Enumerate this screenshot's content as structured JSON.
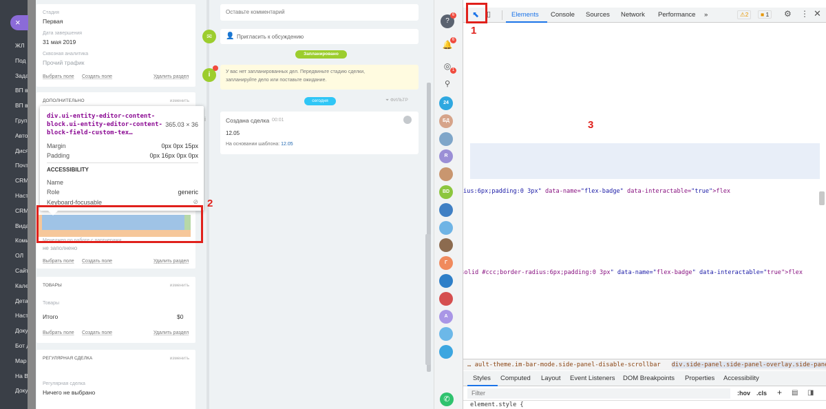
{
  "leftnav": {
    "close": "×",
    "items": [
      "ЖЛ",
      "Под",
      "Зада",
      "ВП в",
      "ВП в",
      "Груп",
      "Авто",
      "Дися",
      "Почт",
      "CRM",
      "Наст",
      "CRM",
      "Вида",
      "Коми",
      "ОЛ",
      "Сайт",
      "Кале",
      "Дета",
      "Наст",
      "Доку",
      "Бот д",
      "Мар",
      "На В",
      "Доку"
    ]
  },
  "crm": {
    "stage_label": "Стадия",
    "stage_value": "Первая",
    "close_date_label": "Дата завершения",
    "close_date_value": "31 мая 2019",
    "source_label": "Сквозная аналитика",
    "source_value": "Прочий трафик",
    "choose_field": "Выбрать поле",
    "create_field": "Создать поле",
    "delete_section": "Удалить раздел",
    "extra_header": "ДОПОЛНИТЕЛЬНО",
    "change": "изменить",
    "manager_label": "Менеджер по работе с партнерами",
    "manager_value": "не заполнено",
    "products_header": "ТОВАРЫ",
    "products_label": "Товары",
    "total_label": "Итого",
    "total_value": "$0",
    "recurring_header": "РЕГУЛЯРНАЯ СДЕЛКА",
    "recurring_label": "Регулярная сделка",
    "recurring_value": "Ничего не выбрано"
  },
  "stream": {
    "comment_placeholder": "Оставьте комментарий",
    "invite": "Пригласить к обсуждению",
    "planned_badge": "Запланировано",
    "info_text_1": "У вас нет запланированных дел. Передвиньте стадию сделки,",
    "info_text_2": "запланируйте дело или поставьте ожидание.",
    "today_badge": "сегодня",
    "filter": "ФИЛЬТР",
    "created_title": "Создана сделка",
    "created_time": "00:01",
    "created_value": "12.05",
    "based_on": "На основании шаблона:",
    "based_on_value": "12.05"
  },
  "tooltip": {
    "selector": "div.ui-entity-editor-content-block.ui-entity-editor-content-block-field-custom-tex…",
    "size": "365.03 × 36",
    "margin_label": "Margin",
    "margin_value": "0px 0px 15px",
    "padding_label": "Padding",
    "padding_value": "0px 16px 0px 0px",
    "accessibility": "ACCESSIBILITY",
    "name_label": "Name",
    "role_label": "Role",
    "role_value": "generic",
    "keyboard_label": "Keyboard-focusable"
  },
  "iconstrip": {
    "badges": [
      "6",
      "6",
      "1"
    ],
    "avatars": [
      {
        "t": "24",
        "c": "#2fa8e0"
      },
      {
        "t": "БД",
        "c": "#d6a48a"
      },
      {
        "t": "",
        "c": "#7fa6c9"
      },
      {
        "t": "R",
        "c": "#9b8fd6"
      },
      {
        "t": "",
        "c": "#c9966f"
      },
      {
        "t": "BD",
        "c": "#8cc63e"
      },
      {
        "t": "",
        "c": "#3f7fc4"
      },
      {
        "t": "",
        "c": "#6fb4e5"
      },
      {
        "t": "",
        "c": "#8c6b4f"
      },
      {
        "t": "Г",
        "c": "#f08a5d"
      },
      {
        "t": "",
        "c": "#2e7fc8"
      },
      {
        "t": "",
        "c": "#d54f4f"
      },
      {
        "t": "A",
        "c": "#a996e6"
      },
      {
        "t": "",
        "c": "#6cb8e8"
      },
      {
        "t": "",
        "c": "#3ca6e0"
      }
    ]
  },
  "devtools": {
    "tabs": [
      "Elements",
      "Console",
      "Sources",
      "Network",
      "Performance",
      "»"
    ],
    "warnings": "2",
    "errors": "1",
    "breadcrumb_1": "… ault-theme.im-bar-mode.side-panel-disable-scrollbar",
    "breadcrumb_2": "div.side-panel.side-panel-overlay.side-panel-overlay-open",
    "subtabs": [
      "Styles",
      "Computed",
      "Layout",
      "Event Listeners",
      "DOM Breakpoints",
      "Properties",
      "Accessibility"
    ],
    "filter_placeholder": "Filter",
    "hov": ":hov",
    ".cls": ".cls",
    "plus": "+",
    "element_style": "element.style {",
    "flex": "flex"
  },
  "annotations": {
    "n1": "1",
    "n2": "2",
    "n3": "3"
  }
}
